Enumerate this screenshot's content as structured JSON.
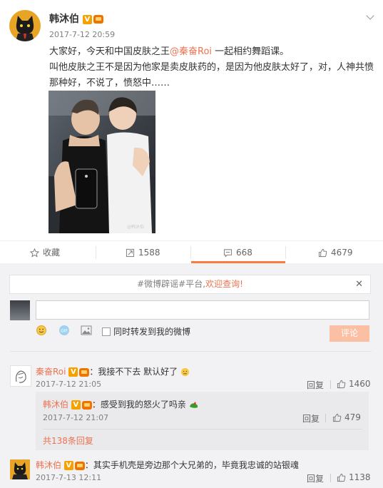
{
  "post": {
    "author": "韩沐伯",
    "time": "2017-7-12 20:59",
    "line1_before": "大家好，今天和中国皮肤之王",
    "line1_mention": "@秦奋Roi",
    "line1_after": " 一起相约舞蹈课。",
    "line2": "叫他皮肤之王不是因为他家是卖皮肤药的，是因为他皮肤太好了，对，人神共愤那种好，不说了，愤怒中……",
    "photo_watermark": "@韩沐伯"
  },
  "actions": {
    "favorite_label": "收藏",
    "repost_count": "1588",
    "comment_count": "668",
    "like_count": "4679"
  },
  "colors": {
    "accent": "#eb7350",
    "active_tab": "#fa7d3c",
    "badge": "#f5a100"
  },
  "notice": {
    "prefix": "#微博辟谣#平台,",
    "highlight": "欢迎查询!",
    "close": "✕"
  },
  "composer": {
    "input_value": "",
    "also_repost_label": "同时转发到我的微博",
    "submit_label": "评论",
    "gif_label": "GIF"
  },
  "comments": [
    {
      "author": "秦奋Roi",
      "text": "：我接不下去 默认好了",
      "time": "2017-7-12 21:05",
      "reply_label": "回复",
      "likes": "1460",
      "replies": [
        {
          "author": "韩沐伯",
          "text": "：感受到我的怒火了吗亲",
          "time": "2017-7-12 21:07",
          "reply_label": "回复",
          "likes": "479"
        }
      ],
      "more_replies": "共138条回复"
    },
    {
      "author": "韩沐伯",
      "text": "：其实手机壳是旁边那个大兄弟的，毕竟我忠诚的站银魂",
      "time": "2017-7-13 12:11",
      "reply_label": "回复",
      "likes": "1138"
    }
  ]
}
